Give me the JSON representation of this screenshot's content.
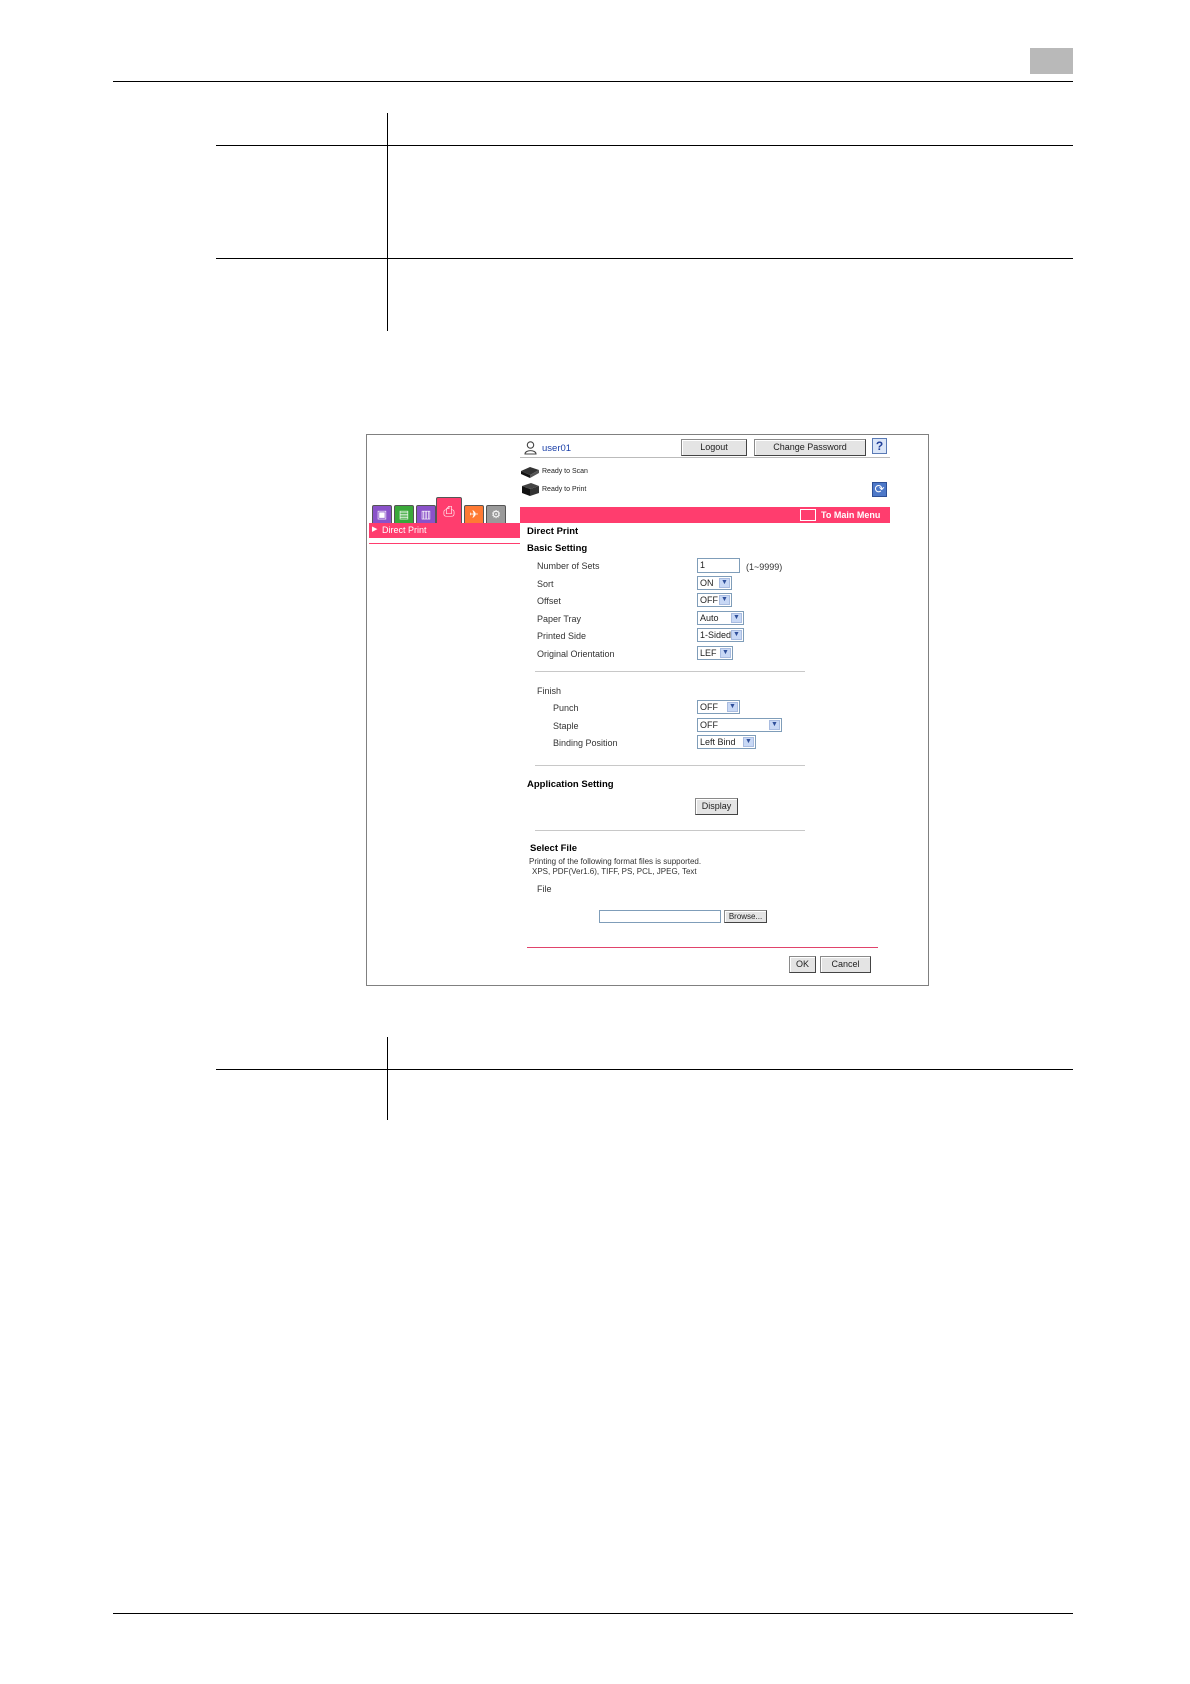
{
  "header": {
    "user": "user01",
    "logout_label": "Logout",
    "change_password_label": "Change Password",
    "help_label": "?"
  },
  "status": {
    "scan": "Ready to Scan",
    "print": "Ready to Print"
  },
  "menu_bar": {
    "to_main_menu": "To Main Menu",
    "accent_color": "#ff3d6e"
  },
  "sidebar": {
    "items": [
      {
        "label": "Direct Print",
        "marker": "▶"
      }
    ]
  },
  "main": {
    "title": "Direct Print",
    "basic_setting": {
      "heading": "Basic Setting",
      "number_of_sets": {
        "label": "Number of Sets",
        "value": "1",
        "range": "(1~9999)"
      },
      "sort": {
        "label": "Sort",
        "value": "ON"
      },
      "offset": {
        "label": "Offset",
        "value": "OFF"
      },
      "paper_tray": {
        "label": "Paper Tray",
        "value": "Auto"
      },
      "printed_side": {
        "label": "Printed Side",
        "value": "1-Sided"
      },
      "original_orientation": {
        "label": "Original Orientation",
        "value": "LEF"
      }
    },
    "finish": {
      "heading": "Finish",
      "punch": {
        "label": "Punch",
        "value": "OFF"
      },
      "staple": {
        "label": "Staple",
        "value": "OFF"
      },
      "binding_position": {
        "label": "Binding Position",
        "value": "Left Bind"
      }
    },
    "application_setting": {
      "heading": "Application Setting",
      "display_label": "Display"
    },
    "select_file": {
      "heading": "Select File",
      "note1": "Printing of the following format files is supported.",
      "note2": "XPS, PDF(Ver1.6), TIFF, PS, PCL, JPEG, Text",
      "file_label": "File",
      "file_value": "",
      "browse_label": "Browse..."
    },
    "ok_label": "OK",
    "cancel_label": "Cancel"
  },
  "icons": {
    "user": "user-icon",
    "scanner": "scanner-icon",
    "printer": "printer-icon",
    "refresh": "refresh-icon",
    "help": "help-icon",
    "main_menu": "main-menu-icon",
    "dropdown": "▼"
  }
}
